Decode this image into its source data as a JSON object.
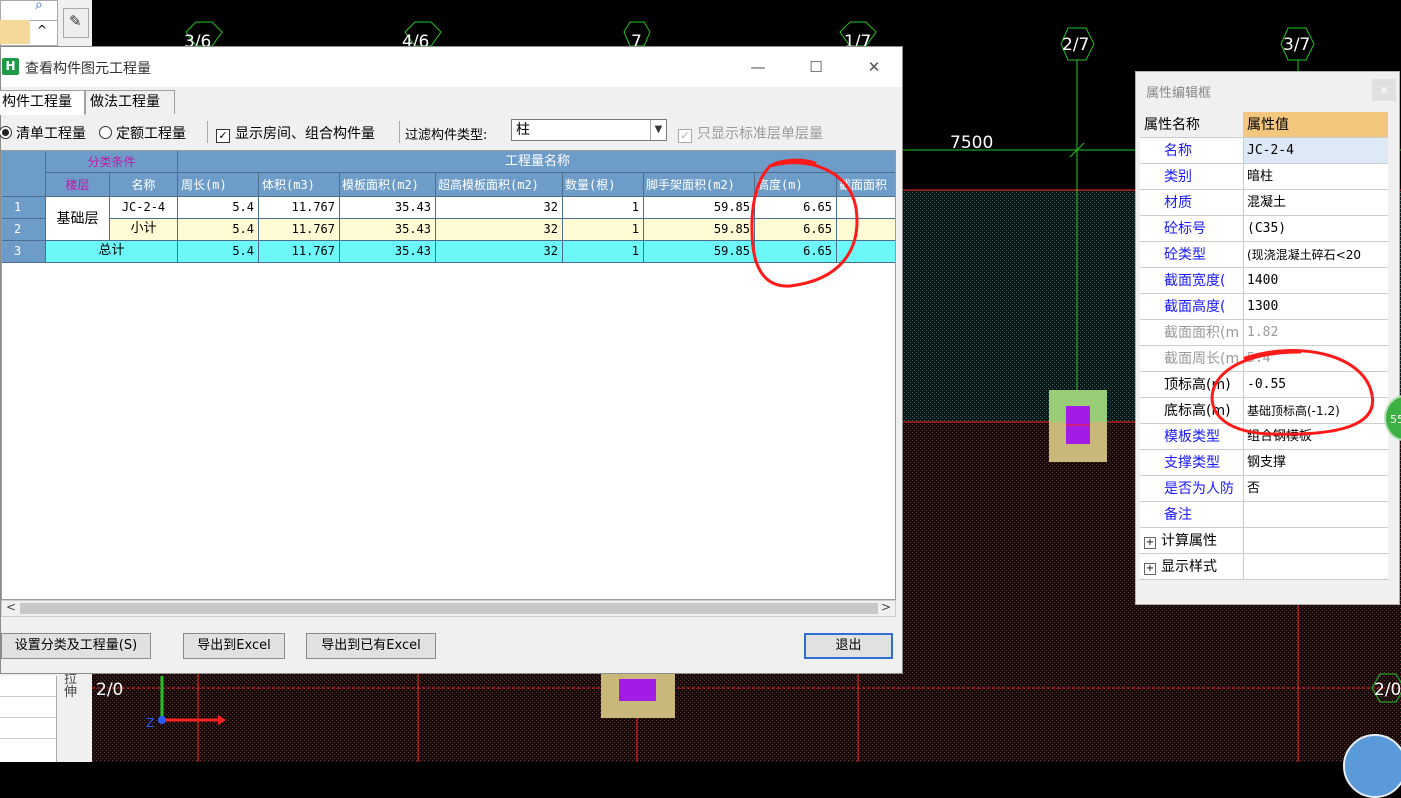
{
  "cad": {
    "axis_labels_top": [
      "3/6",
      "4/6",
      "7",
      "1/7",
      "2/7",
      "3/7"
    ],
    "axis_labels_bottom": [
      "2/0",
      "2/0"
    ],
    "dimension_text": "7500",
    "stretch_label": "拉伸",
    "colors": {
      "background": "#000000",
      "grid_red": "#ff2020",
      "grid_green": "#22c322",
      "column_khaki": "#c8b97a",
      "column_purple": "#a21ce6",
      "column_green": "#99cc77"
    }
  },
  "qty_dialog": {
    "title": "查看构件图元工程量",
    "icon_letter": "H",
    "window_controls": {
      "minimize": "—",
      "maximize": "☐",
      "close": "✕"
    },
    "tabs": [
      "构件工程量",
      "做法工程量"
    ],
    "options": {
      "radio_list": "清单工程量",
      "radio_quota": "定额工程量",
      "checkbox_rooms": "显示房间、组合构件量",
      "filter_label": "过滤构件类型:",
      "filter_value": "柱",
      "checkbox_std_floor": "只显示标准层单层量"
    },
    "grid": {
      "group_headers": {
        "classify": "分类条件",
        "quantity": "工程量名称"
      },
      "columns": [
        "楼层",
        "名称",
        "周长(m)",
        "体积(m3)",
        "模板面积(m2)",
        "超高模板面积(m2)",
        "数量(根)",
        "脚手架面积(m2)",
        "高度(m)",
        "截面面积"
      ],
      "floor": "基础层",
      "rows": [
        {
          "index": "1",
          "name": "JC-2-4",
          "perimeter": "5.4",
          "volume": "11.767",
          "formwork": "35.43",
          "high_formwork": "32",
          "count": "1",
          "scaffold": "59.85",
          "height": "6.65"
        },
        {
          "index": "2",
          "name": "小计",
          "perimeter": "5.4",
          "volume": "11.767",
          "formwork": "35.43",
          "high_formwork": "32",
          "count": "1",
          "scaffold": "59.85",
          "height": "6.65"
        },
        {
          "index": "3",
          "name": "总计",
          "perimeter": "5.4",
          "volume": "11.767",
          "formwork": "35.43",
          "high_formwork": "32",
          "count": "1",
          "scaffold": "59.85",
          "height": "6.65"
        }
      ]
    },
    "buttons": {
      "set_classify": "设置分类及工程量(S)",
      "export_excel": "导出到Excel",
      "export_existing": "导出到已有Excel",
      "exit": "退出"
    }
  },
  "prop_panel": {
    "title": "属性编辑框",
    "close": "×",
    "header": {
      "name": "属性名称",
      "value": "属性值"
    },
    "rows": [
      {
        "name": "名称",
        "value": "JC-2-4"
      },
      {
        "name": "类别",
        "value": "暗柱"
      },
      {
        "name": "材质",
        "value": "混凝土"
      },
      {
        "name": "砼标号",
        "value": "(C35)"
      },
      {
        "name": "砼类型",
        "value": "(现浇混凝土碎石<20"
      },
      {
        "name": "截面宽度(",
        "value": "1400"
      },
      {
        "name": "截面高度(",
        "value": "1300"
      },
      {
        "name": "截面面积(m",
        "value": "1.82"
      },
      {
        "name": "截面周长(m",
        "value": "5.4"
      },
      {
        "name": "顶标高(m)",
        "value": "-0.55"
      },
      {
        "name": "底标高(m)",
        "value": "基础顶标高(-1.2)"
      },
      {
        "name": "模板类型",
        "value": "组合钢模板"
      },
      {
        "name": "支撑类型",
        "value": "钢支撑"
      },
      {
        "name": "是否为人防",
        "value": "否"
      },
      {
        "name": "备注",
        "value": ""
      },
      {
        "name": "计算属性",
        "value": ""
      },
      {
        "name": "显示样式",
        "value": ""
      }
    ]
  },
  "badge": {
    "text": "55"
  }
}
